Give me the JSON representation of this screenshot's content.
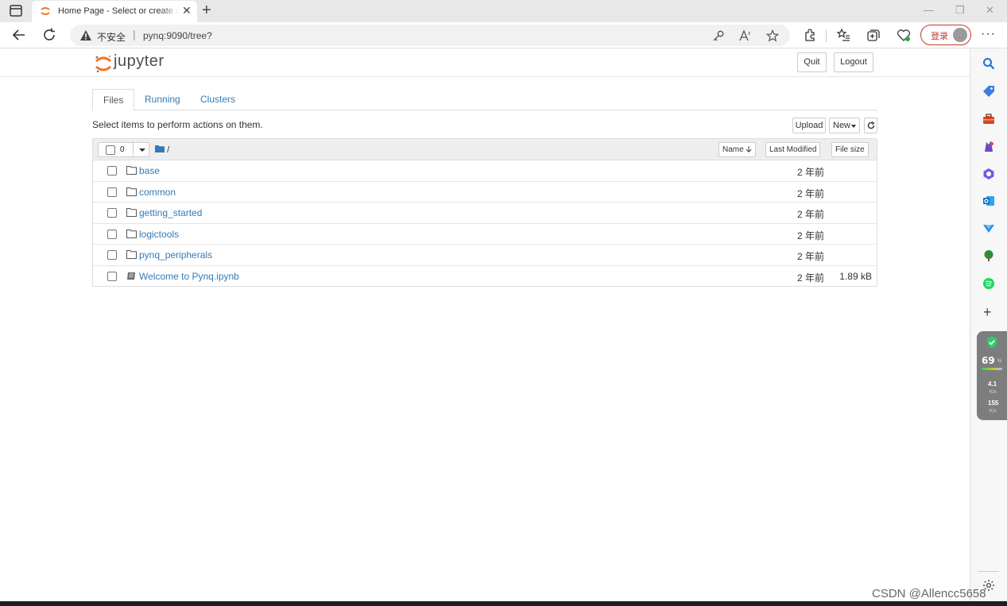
{
  "browser": {
    "tab_title": "Home Page - Select or create a notebook",
    "security_label": "不安全",
    "url": "pynq:9090/tree?",
    "login_label": "登录"
  },
  "header": {
    "logo_text": "jupyter",
    "quit_label": "Quit",
    "logout_label": "Logout"
  },
  "tabs": [
    {
      "label": "Files",
      "active": true
    },
    {
      "label": "Running",
      "active": false
    },
    {
      "label": "Clusters",
      "active": false
    }
  ],
  "toolbar": {
    "hint": "Select items to perform actions on them.",
    "upload_label": "Upload",
    "new_label": "New"
  },
  "list_header": {
    "selected_count": "0",
    "breadcrumb": "/",
    "name_label": "Name",
    "last_modified_label": "Last Modified",
    "file_size_label": "File size"
  },
  "files": [
    {
      "name": "base",
      "type": "folder",
      "modified": "2 年前",
      "size": ""
    },
    {
      "name": "common",
      "type": "folder",
      "modified": "2 年前",
      "size": ""
    },
    {
      "name": "getting_started",
      "type": "folder",
      "modified": "2 年前",
      "size": ""
    },
    {
      "name": "logictools",
      "type": "folder",
      "modified": "2 年前",
      "size": ""
    },
    {
      "name": "pynq_peripherals",
      "type": "folder",
      "modified": "2 年前",
      "size": ""
    },
    {
      "name": "Welcome to Pynq.ipynb",
      "type": "notebook",
      "modified": "2 年前",
      "size": "1.89 kB"
    }
  ],
  "sidebar_widget": {
    "percent": "69",
    "upload_speed": "4.1",
    "download_speed": "155",
    "unit": "K/s"
  },
  "watermark": "CSDN @Allencc5658",
  "colors": {
    "link": "#337ab7",
    "jupyter_orange": "#f37726",
    "insecure_warning": "#c0392b"
  }
}
